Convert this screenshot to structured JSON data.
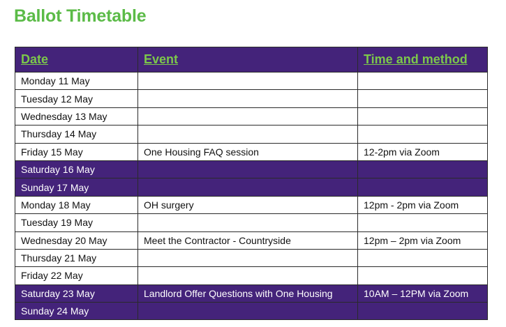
{
  "title": "Ballot Timetable",
  "table": {
    "headers": [
      "Date",
      "Event",
      "Time and method"
    ],
    "rows": [
      {
        "date": "Monday 11 May",
        "event": "",
        "time": "",
        "weekend": false
      },
      {
        "date": "Tuesday 12 May",
        "event": "",
        "time": "",
        "weekend": false
      },
      {
        "date": "Wednesday 13 May",
        "event": "",
        "time": "",
        "weekend": false
      },
      {
        "date": "Thursday 14 May",
        "event": "",
        "time": "",
        "weekend": false
      },
      {
        "date": "Friday 15 May",
        "event": "One Housing FAQ session",
        "time": "12-2pm via Zoom",
        "weekend": false
      },
      {
        "date": "Saturday 16 May",
        "event": "",
        "time": "",
        "weekend": true
      },
      {
        "date": "Sunday 17 May",
        "event": "",
        "time": "",
        "weekend": true
      },
      {
        "date": "Monday 18 May",
        "event": "OH surgery",
        "time": "12pm - 2pm via Zoom",
        "weekend": false
      },
      {
        "date": "Tuesday 19 May",
        "event": "",
        "time": "",
        "weekend": false
      },
      {
        "date": "Wednesday 20 May",
        "event": "Meet the Contractor - Countryside",
        "time": "12pm – 2pm via Zoom",
        "weekend": false
      },
      {
        "date": "Thursday 21 May",
        "event": "",
        "time": "",
        "weekend": false
      },
      {
        "date": "Friday 22 May",
        "event": "",
        "time": "",
        "weekend": false
      },
      {
        "date": "Saturday 23 May",
        "event": "Landlord Offer Questions with One Housing",
        "time": "10AM – 12PM via Zoom",
        "weekend": true
      },
      {
        "date": "Sunday 24 May",
        "event": "",
        "time": "",
        "weekend": true
      }
    ]
  },
  "colors": {
    "title": "#5bbb47",
    "header_bg": "#44237a",
    "header_text": "#7cc84a",
    "weekend_bg": "#44237a",
    "weekend_text": "#ffffff"
  }
}
